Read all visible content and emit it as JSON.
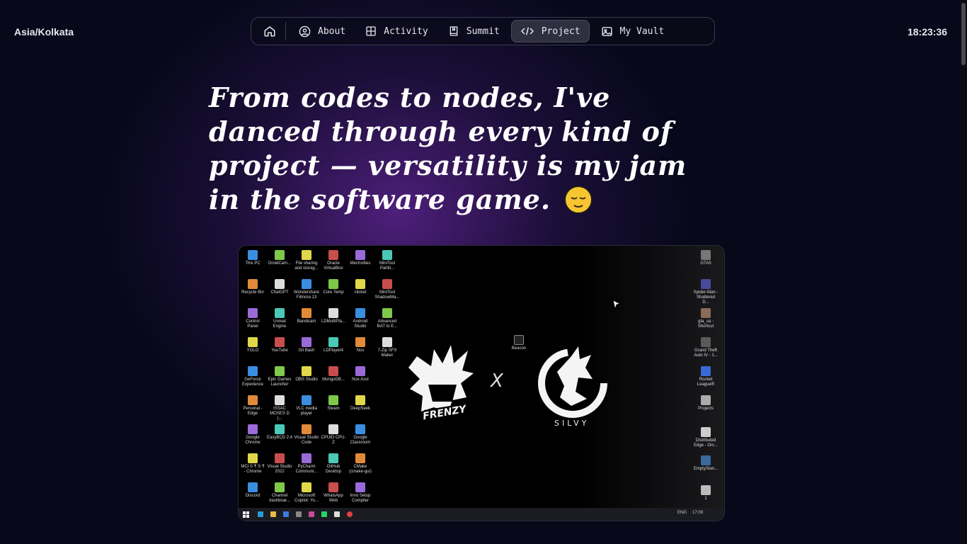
{
  "header": {
    "timezone": "Asia/Kolkata",
    "clock": "18:23:36"
  },
  "nav": {
    "home_icon": "home-icon",
    "items": [
      {
        "label": "About",
        "icon": "user-circle-icon",
        "active": false
      },
      {
        "label": "Activity",
        "icon": "grid-icon",
        "active": false
      },
      {
        "label": "Summit",
        "icon": "book-icon",
        "active": false
      },
      {
        "label": "Project",
        "icon": "code-icon",
        "active": true
      },
      {
        "label": "My Vault",
        "icon": "image-icon",
        "active": false
      }
    ]
  },
  "hero": {
    "headline": "From codes to nodes, I've danced through every kind of project — versatility is my jam in the software game.",
    "emoji": "relieved-face-emoji"
  },
  "screenshot": {
    "desktop_icons_left": [
      [
        "This PC",
        "DroidCam...",
        "File sharing and storag...",
        "Oracle VirtualBox",
        "Mechvibes",
        "MiniTool Partiti..."
      ],
      [
        "Recycle Bin",
        "ChatGPT",
        "Wondershare Filmora 13",
        "Core Temp",
        "clicket",
        "MiniTool ShadowMa..."
      ],
      [
        "Control Panel",
        "Unreal Engine",
        "Bandicam",
        "LDMultiPla...",
        "Android Studio",
        "Advanced BAT to E..."
      ],
      [
        "YOLO",
        "YouTube",
        "Git Bash",
        "LDPlayer4",
        "Nox",
        "7-Zip SFX Maker"
      ],
      [
        "GeForce Experience",
        "Epic Games Launcher",
        "OBS Studio",
        "MongoDB...",
        "Nox Asst",
        ""
      ],
      [
        "Personal - Edge",
        "ISSAC MOSES D (...",
        "VLC media player",
        "Steam",
        "DeepSeek",
        ""
      ],
      [
        "Google Chrome",
        "EasyBCD 2.4",
        "Visual Studio Code",
        "CPUID CPU-Z",
        "Google Classroom",
        ""
      ],
      [
        "MCI S ₹ S ₹ - Chrome",
        "Visual Studio 2022",
        "PyCharm Communi...",
        "GitHub Desktop",
        "CMake (cmake-gui)",
        ""
      ],
      [
        "Discord",
        "Channel dashboar...",
        "Microsoft Copilot: Yo...",
        "WhatsApp Web",
        "Inno Setup Compiler",
        ""
      ]
    ],
    "desktop_icons_right": [
      "GTA5",
      "Spider-Man - Shattered D...",
      "gta_sa - Shortcut",
      "Grand Theft Auto IV - 1...",
      "Rocket League®",
      "Projects",
      "Distributed Edge - Orc...",
      "EmptyStan...",
      "1"
    ],
    "beacon_label": "Beacon",
    "logo_left_text": "FRENZY",
    "logo_right_text": "SILVY",
    "cross": "X",
    "tray": {
      "lang": "ENG",
      "time": "17:09"
    },
    "colors": {
      "accent": "#5a238c",
      "bg": "#07081a"
    }
  }
}
